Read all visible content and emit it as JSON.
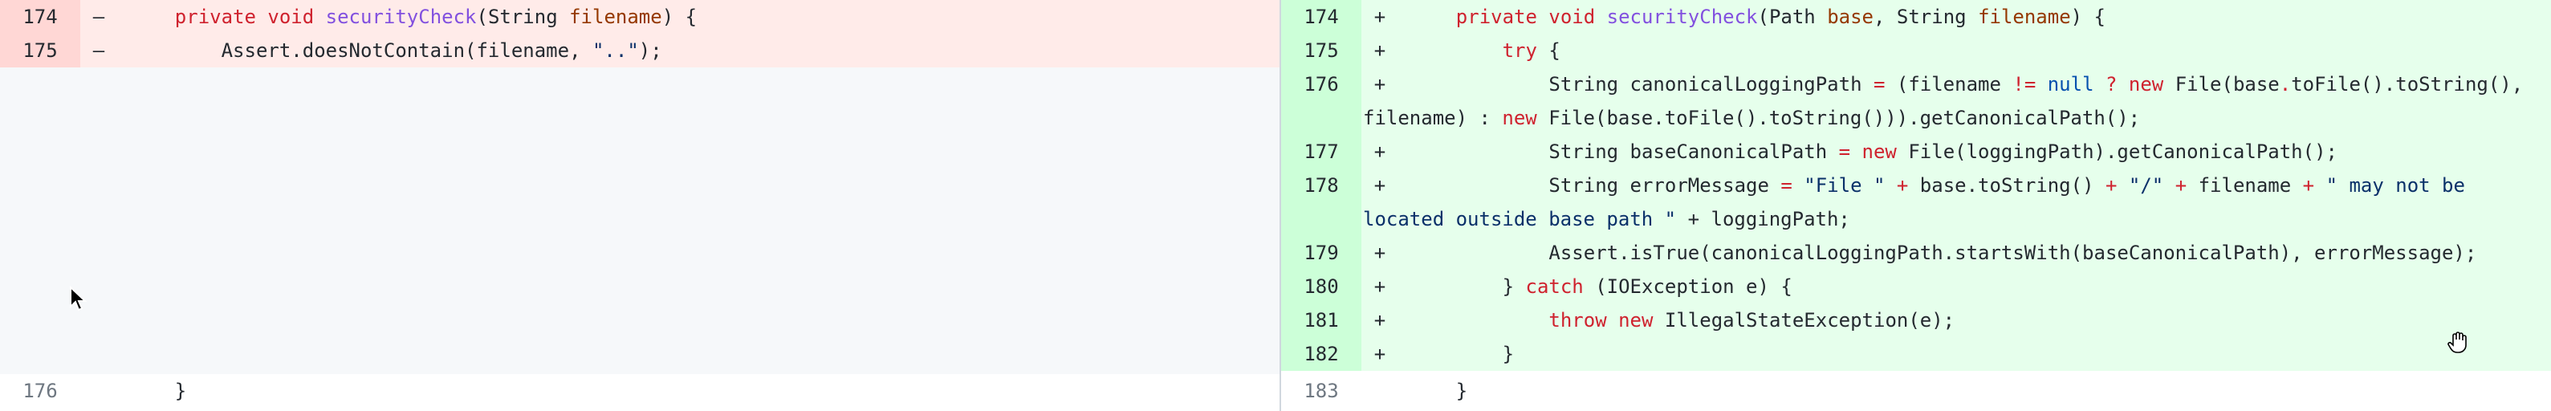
{
  "left": {
    "lines": [
      {
        "num": "174",
        "sign": "–"
      },
      {
        "num": "175",
        "sign": "–"
      },
      {
        "num": "176",
        "sign": ""
      }
    ]
  },
  "right": {
    "lines": [
      {
        "num": "174",
        "sign": "+"
      },
      {
        "num": "175",
        "sign": "+"
      },
      {
        "num": "176",
        "sign": "+"
      },
      {
        "num": "177",
        "sign": "+"
      },
      {
        "num": "178",
        "sign": "+"
      },
      {
        "num": "179",
        "sign": "+"
      },
      {
        "num": "180",
        "sign": "+"
      },
      {
        "num": "181",
        "sign": "+"
      },
      {
        "num": "182",
        "sign": "+"
      },
      {
        "num": "183",
        "sign": ""
      }
    ]
  },
  "tokens": {
    "private": "private",
    "void": "void",
    "securityCheck": "securityCheck",
    "String": "String",
    "filename": "filename",
    "Path": "Path",
    "base": "base",
    "try": "try",
    "new": "new",
    "null": "null",
    "catch": "catch",
    "throw": "throw",
    "dotdot": "\"..\"",
    "file_str": "\"File \"",
    "slash_str": "\"/\"",
    "may_not_be": "\" may not be",
    "located_outside": "located outside base path \"",
    "assert_not_contain": "Assert.doesNotContain(filename, ",
    "close_paren_semicolon": ");",
    "left_close_brace": "}",
    "canonical_line_part1": "String canonicalLoggingPath ",
    "canonical_line_part2": "(filename ",
    "canonical_line_part3": " File(base",
    "canonical_line_part4": "toFile().toString(),",
    "canonical_line_cont": "filename) : ",
    "canonical_line_cont2": " File(base.toFile().toString())).getCanonicalPath();",
    "base_canon_part1": "String baseCanonicalPath ",
    "base_canon_part2": " File(loggingPath).getCanonicalPath();",
    "error_msg_part1": "String errorMessage ",
    "error_msg_part2": " base.toString() ",
    "error_msg_part3": " filename ",
    "logging_tail": " + loggingPath;",
    "assert_is_true": "Assert.isTrue(canonicalLoggingPath.startsWith(baseCanonicalPath), errorMessage);",
    "ioexception": " (IOException e) {",
    "illegal_state": " IllegalStateException(e);"
  }
}
